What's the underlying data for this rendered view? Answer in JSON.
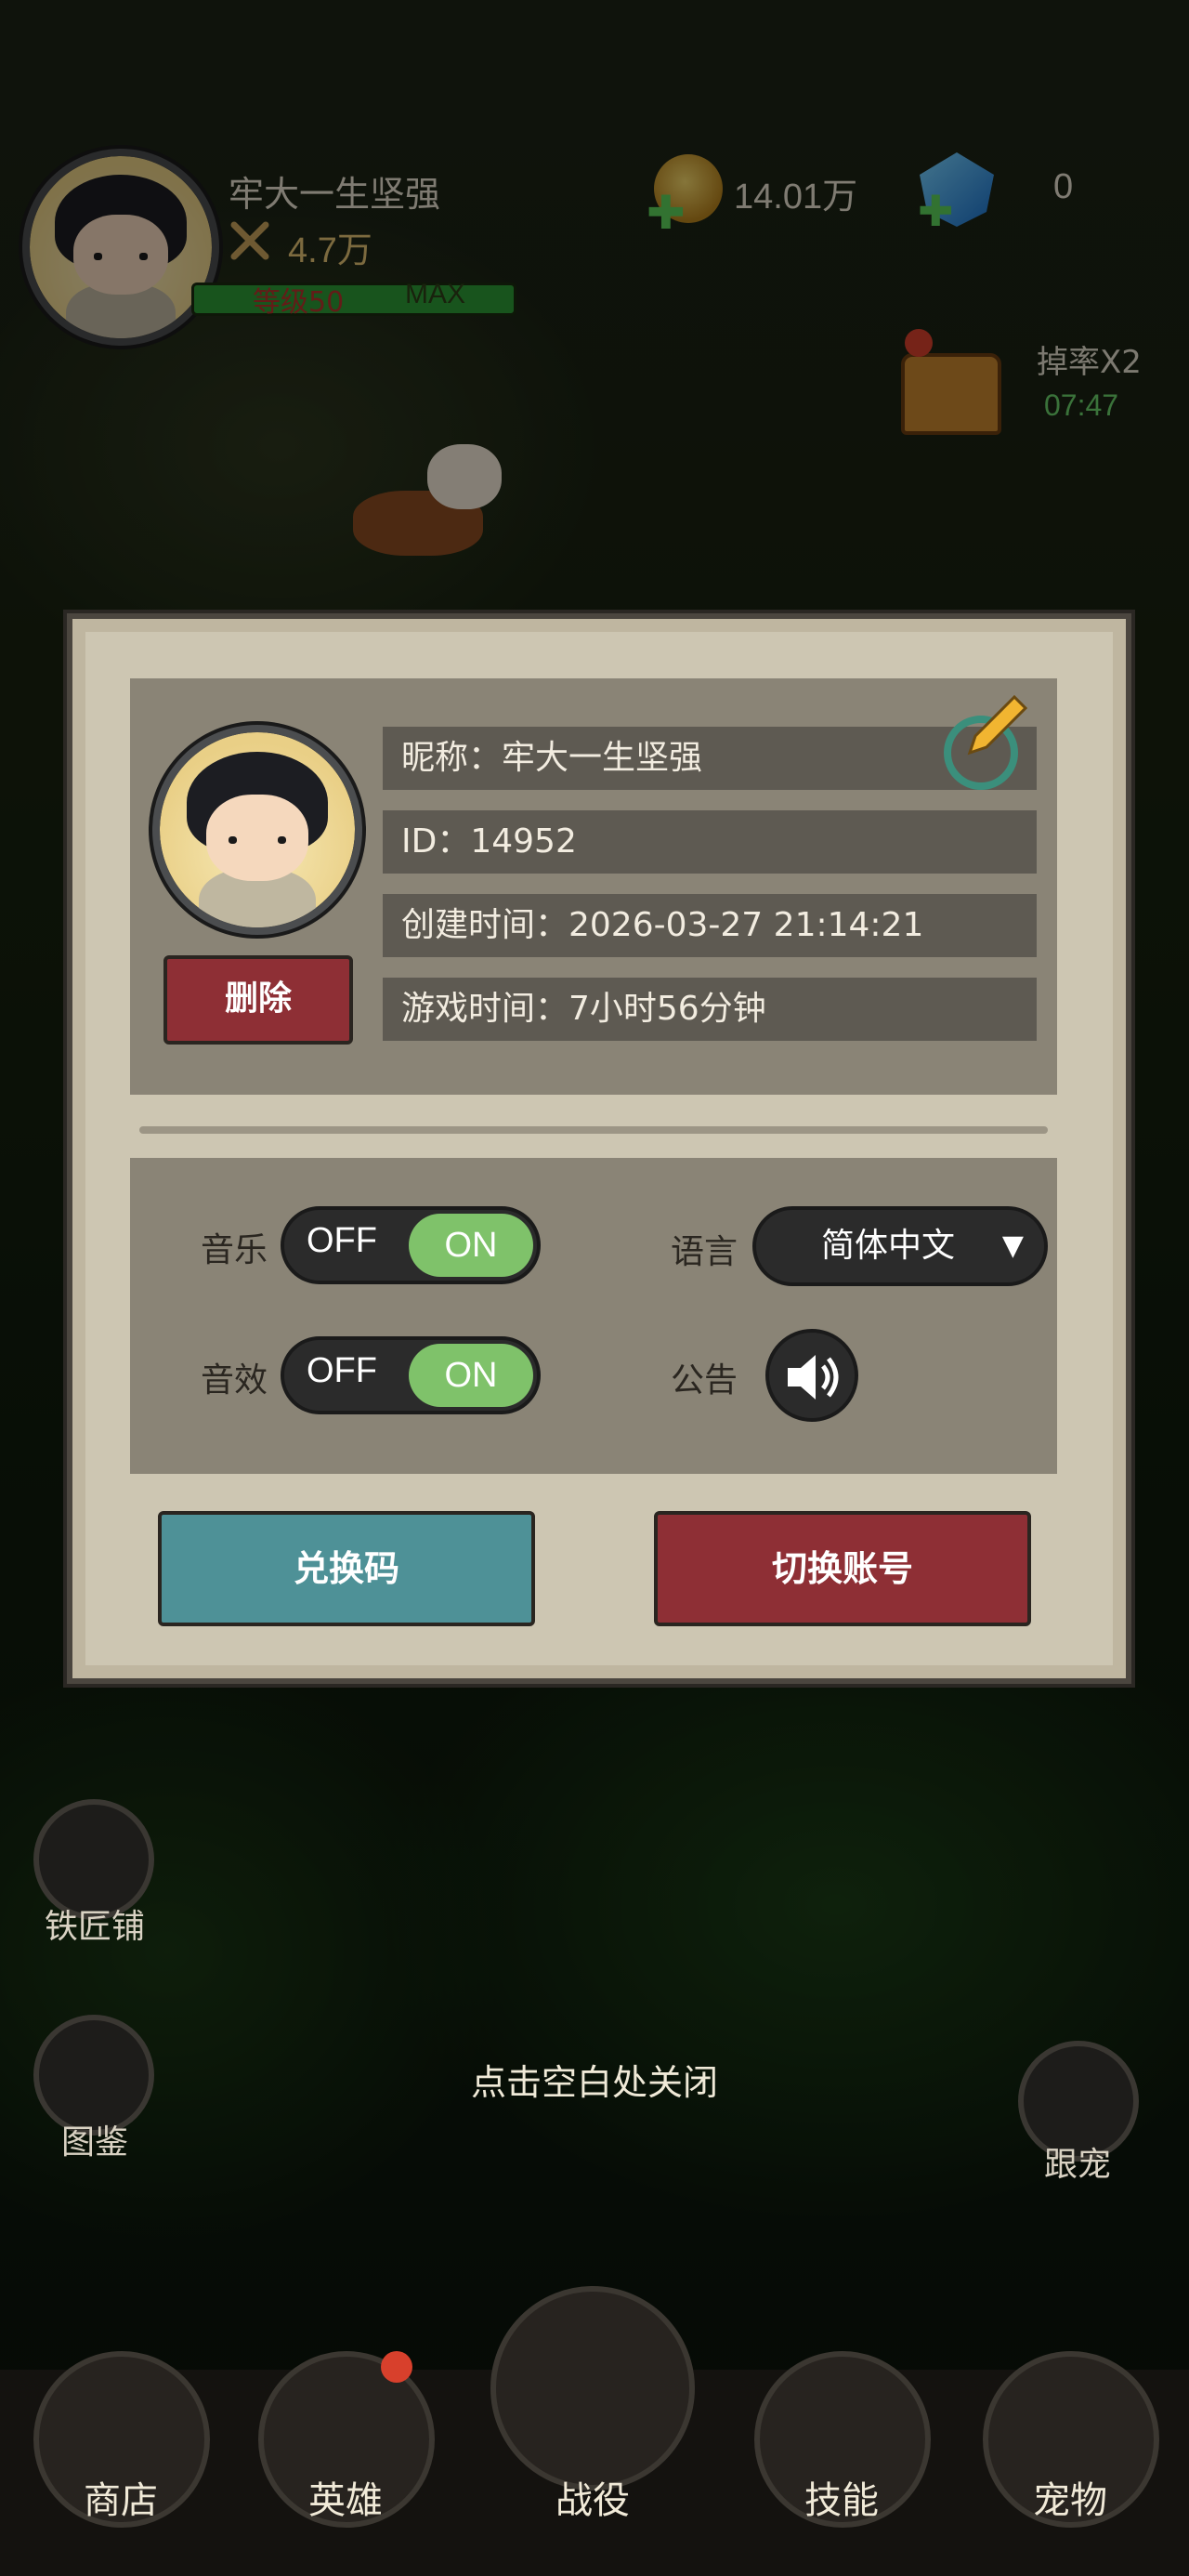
{
  "hud": {
    "player_name": "牢大一生坚强",
    "power": "4.7万",
    "level_text": "等级50",
    "level_max": "MAX",
    "gold": "14.01万",
    "gems": "0",
    "drop_rate": "掉率X2",
    "drop_timer": "07:47"
  },
  "profile": {
    "nickname": "昵称：牢大一生坚强",
    "id": "ID：14952",
    "created": "创建时间：2026-03-27 21:14:21",
    "playtime": "游戏时间：7小时56分钟",
    "delete_label": "删除"
  },
  "settings": {
    "music_label": "音乐",
    "sfx_label": "音效",
    "off": "OFF",
    "on": "ON",
    "language_label": "语言",
    "language_value": "简体中文",
    "notice_label": "公告"
  },
  "actions": {
    "redeem_label": "兑换码",
    "switch_account_label": "切换账号"
  },
  "side": {
    "blacksmith": "铁匠铺",
    "codex": "图鉴",
    "pet_follow": "跟宠"
  },
  "close_hint": "点击空白处关闭",
  "nav": {
    "shop": "商店",
    "hero": "英雄",
    "battle": "战役",
    "skill": "技能",
    "pet": "宠物"
  },
  "colors": {
    "panel": "#cdc6b2",
    "redeem": "#4e9197",
    "switch": "#8e2f35",
    "toggle_on": "#7fc26a",
    "level_bar": "#2d9a36"
  }
}
